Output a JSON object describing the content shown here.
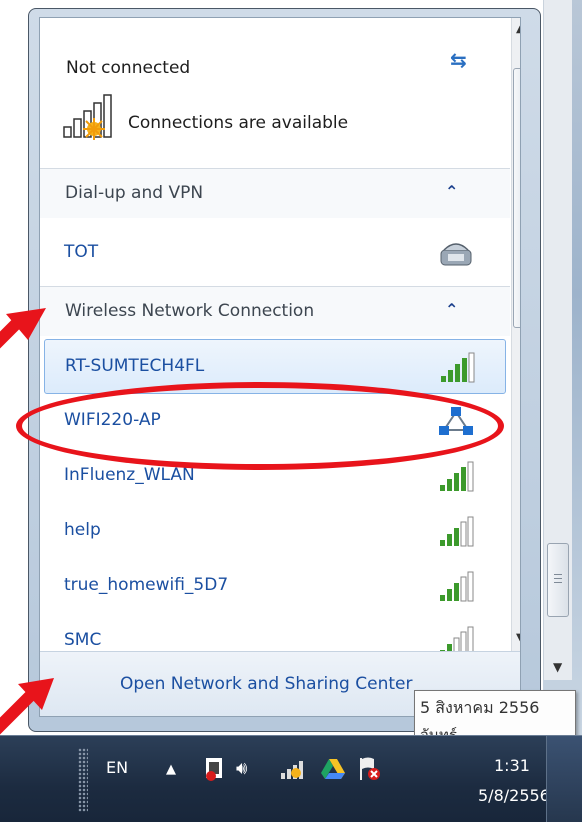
{
  "flyout": {
    "status": "Not connected",
    "availability": "Connections are available",
    "sections": {
      "dialup": {
        "label": "Dial-up and VPN"
      },
      "wireless": {
        "label": "Wireless Network Connection"
      }
    },
    "dialup_items": [
      {
        "name": "TOT"
      }
    ],
    "networks": [
      {
        "name": "RT-SUMTECH4FL",
        "signal": 4,
        "selected": true
      },
      {
        "name": "WIFI220-AP",
        "signal": 0,
        "type": "adhoc"
      },
      {
        "name": "InFluenz_WLAN",
        "signal": 4
      },
      {
        "name": "help",
        "signal": 3
      },
      {
        "name": "true_homewifi_5D7",
        "signal": 3
      },
      {
        "name": "SMC",
        "signal": 2
      }
    ],
    "footer_link": "Open Network and Sharing Center"
  },
  "tooltip": {
    "line1": "5 สิงหาคม 2556",
    "line2": "จันทร์"
  },
  "taskbar": {
    "language": "EN",
    "clock_time": "1:31",
    "clock_date": "5/8/2556"
  },
  "icons": {
    "refresh": "refresh-icon",
    "chevron": "chevron-up-icon",
    "modem": "modem-phone-icon",
    "signal": "wifi-signal-icon",
    "adhoc": "adhoc-network-icon"
  },
  "colors": {
    "annotation": "#e8141b",
    "link": "#1b4fa1"
  }
}
